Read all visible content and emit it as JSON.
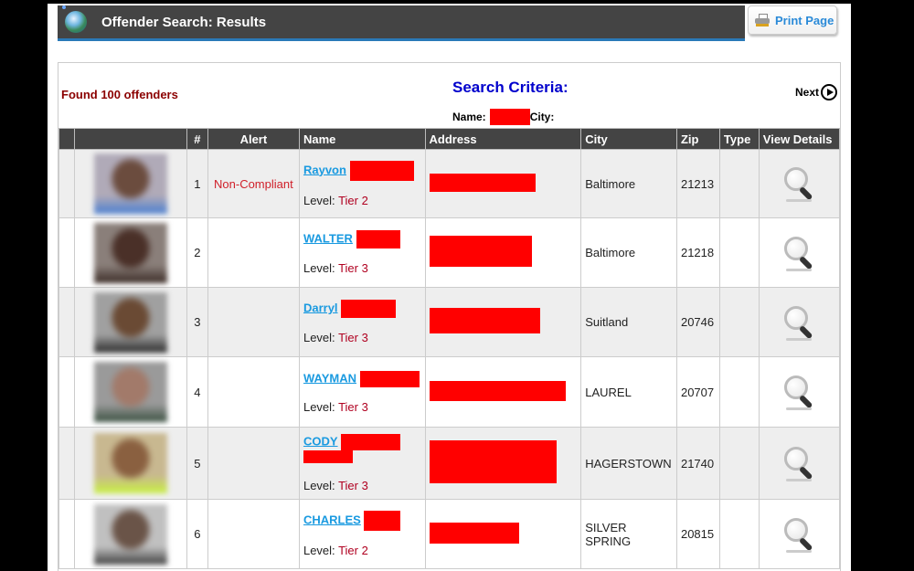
{
  "header": {
    "title": "Offender Search: Results",
    "print_label": "Print Page",
    "icon": "globe-icon"
  },
  "summary": {
    "found_text": "Found 100 offenders",
    "criteria_title": "Search Criteria:",
    "name_label": "Name:",
    "city_label": "City:",
    "next_label": "Next"
  },
  "table": {
    "headers": [
      "",
      "",
      "#",
      "Alert",
      "Name",
      "Address",
      "City",
      "Zip",
      "Type",
      "View Details"
    ],
    "level_label": "Level:",
    "rows": [
      {
        "num": "1",
        "alert": "Non-Compliant",
        "first_name": "Rayvon",
        "tier": "Tier 2",
        "city": "Baltimore",
        "zip": "21213",
        "type": "",
        "photo_colors": [
          "#b0aab8",
          "#6b4c3e",
          "#4a7ed0"
        ]
      },
      {
        "num": "2",
        "alert": "",
        "first_name": "WALTER",
        "tier": "Tier 3",
        "city": "Baltimore",
        "zip": "21218",
        "type": "",
        "photo_colors": [
          "#8a7f7a",
          "#4a3028",
          "#3a2a24"
        ]
      },
      {
        "num": "3",
        "alert": "",
        "first_name": "Darryl",
        "tier": "Tier 3",
        "city": "Suitland",
        "zip": "20746",
        "type": "",
        "photo_colors": [
          "#a0a0a0",
          "#6a4a34",
          "#2a2a2a"
        ]
      },
      {
        "num": "4",
        "alert": "",
        "first_name": "WAYMAN",
        "tier": "Tier 3",
        "city": "LAUREL",
        "zip": "20707",
        "type": "",
        "photo_colors": [
          "#9a9a9a",
          "#a27a6a",
          "#3a5040"
        ]
      },
      {
        "num": "5",
        "alert": "",
        "first_name": "CODY",
        "tier": "Tier 3",
        "city": "HAGERSTOWN",
        "zip": "21740",
        "type": "",
        "photo_colors": [
          "#c8b890",
          "#8a6040",
          "#c8f040"
        ]
      },
      {
        "num": "6",
        "alert": "",
        "first_name": "CHARLES",
        "tier": "Tier 2",
        "city": "SILVER SPRING",
        "zip": "20815",
        "type": "",
        "photo_colors": [
          "#c0c0c0",
          "#6a5448",
          "#404040"
        ]
      }
    ]
  },
  "colors": {
    "redaction": "#ff0000",
    "header_bg": "#444444",
    "link": "#1a9ae0",
    "found": "#8b0000",
    "criteria": "#0000cc"
  }
}
